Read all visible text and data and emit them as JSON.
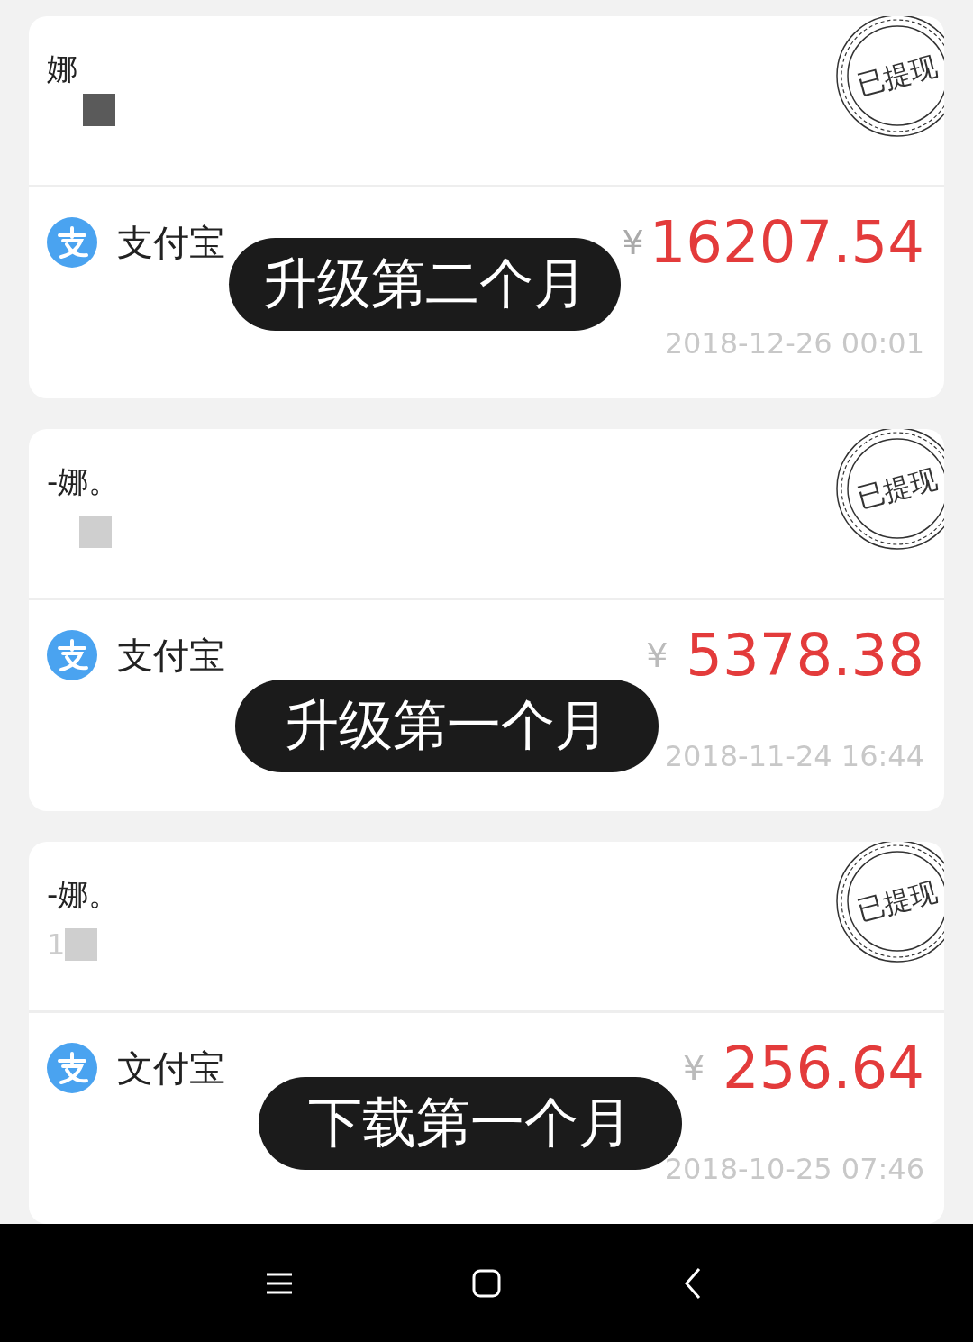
{
  "records": [
    {
      "name": "娜",
      "stamp": "已提现",
      "method": "支付宝",
      "currency": "¥",
      "amount": "16207.54",
      "time": "2018-12-26 00:01",
      "overlay": "升级第二个月"
    },
    {
      "name": "-娜。",
      "stamp": "已提现",
      "method": "支付宝",
      "currency": "¥",
      "amount": "5378.38",
      "time": "2018-11-24 16:44",
      "overlay": "升级第一个月"
    },
    {
      "name": "-娜。",
      "account_prefix": "1",
      "stamp": "已提现",
      "method": "文付宝",
      "currency": "¥",
      "amount": "256.64",
      "time": "2018-10-25 07:46",
      "overlay": "下载第一个月"
    }
  ],
  "nav_bar": {
    "buttons": [
      {
        "kind": "menu"
      },
      {
        "kind": "home"
      },
      {
        "kind": "back"
      }
    ]
  }
}
